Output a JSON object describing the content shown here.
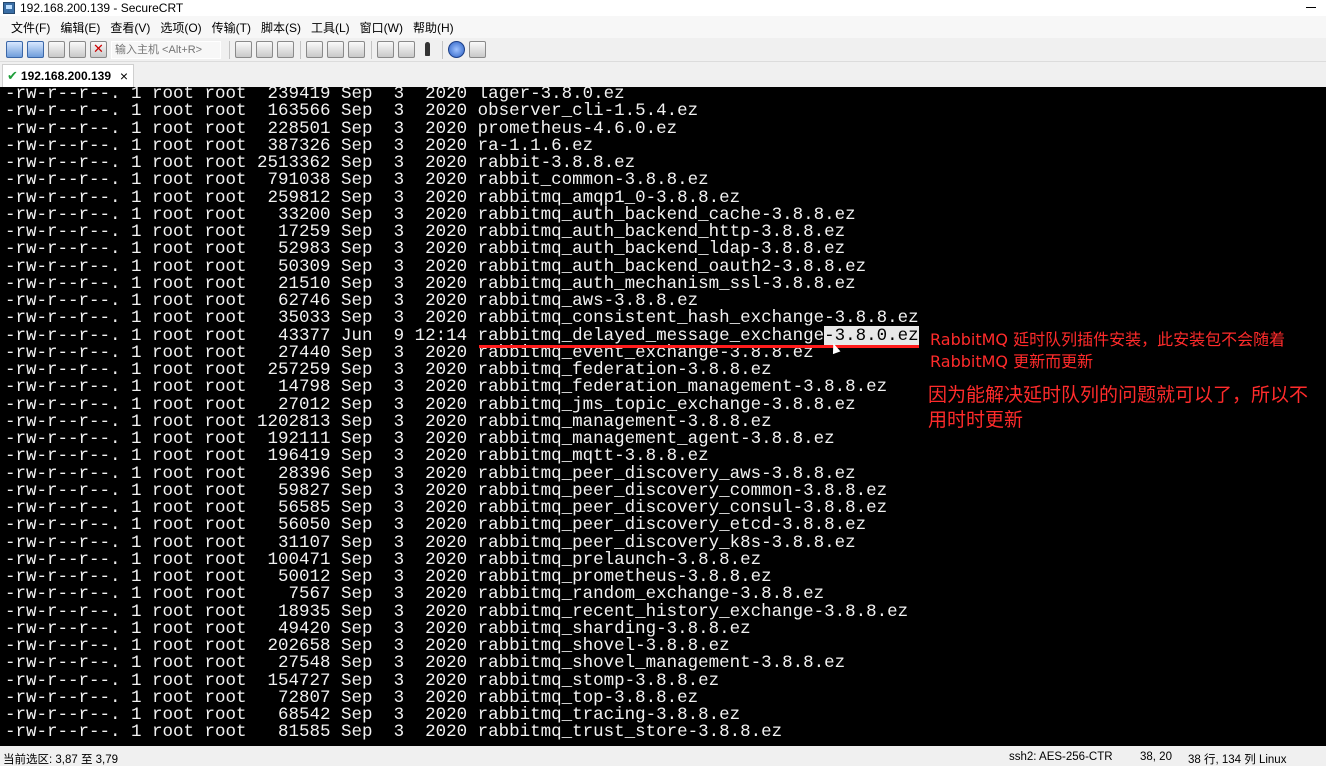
{
  "window": {
    "title": "192.168.200.139 - SecureCRT"
  },
  "menu": [
    "文件(F)",
    "编辑(E)",
    "查看(V)",
    "选项(O)",
    "传输(T)",
    "脚本(S)",
    "工具(L)",
    "窗口(W)",
    "帮助(H)"
  ],
  "toolbar": {
    "host_placeholder": "输入主机 <Alt+R>"
  },
  "tab": {
    "label": "192.168.200.139",
    "close": "×"
  },
  "terminal": {
    "lines": [
      "-rw-r--r--. 1 root root  239419 Sep  3  2020 lager-3.8.0.ez",
      "-rw-r--r--. 1 root root  163566 Sep  3  2020 observer_cli-1.5.4.ez",
      "-rw-r--r--. 1 root root  228501 Sep  3  2020 prometheus-4.6.0.ez",
      "-rw-r--r--. 1 root root  387326 Sep  3  2020 ra-1.1.6.ez",
      "-rw-r--r--. 1 root root 2513362 Sep  3  2020 rabbit-3.8.8.ez",
      "-rw-r--r--. 1 root root  791038 Sep  3  2020 rabbit_common-3.8.8.ez",
      "-rw-r--r--. 1 root root  259812 Sep  3  2020 rabbitmq_amqp1_0-3.8.8.ez",
      "-rw-r--r--. 1 root root   33200 Sep  3  2020 rabbitmq_auth_backend_cache-3.8.8.ez",
      "-rw-r--r--. 1 root root   17259 Sep  3  2020 rabbitmq_auth_backend_http-3.8.8.ez",
      "-rw-r--r--. 1 root root   52983 Sep  3  2020 rabbitmq_auth_backend_ldap-3.8.8.ez",
      "-rw-r--r--. 1 root root   50309 Sep  3  2020 rabbitmq_auth_backend_oauth2-3.8.8.ez",
      "-rw-r--r--. 1 root root   21510 Sep  3  2020 rabbitmq_auth_mechanism_ssl-3.8.8.ez",
      "-rw-r--r--. 1 root root   62746 Sep  3  2020 rabbitmq_aws-3.8.8.ez",
      "-rw-r--r--. 1 root root   35033 Sep  3  2020 rabbitmq_consistent_hash_exchange-3.8.8.ez",
      "-rw-r--r--. 1 root root   43377 Jun  9 12:14 rabbitmq_delayed_message_exchange-3.8.0.ez",
      "-rw-r--r--. 1 root root   27440 Sep  3  2020 rabbitmq_event_exchange-3.8.8.ez",
      "-rw-r--r--. 1 root root  257259 Sep  3  2020 rabbitmq_federation-3.8.8.ez",
      "-rw-r--r--. 1 root root   14798 Sep  3  2020 rabbitmq_federation_management-3.8.8.ez",
      "-rw-r--r--. 1 root root   27012 Sep  3  2020 rabbitmq_jms_topic_exchange-3.8.8.ez",
      "-rw-r--r--. 1 root root 1202813 Sep  3  2020 rabbitmq_management-3.8.8.ez",
      "-rw-r--r--. 1 root root  192111 Sep  3  2020 rabbitmq_management_agent-3.8.8.ez",
      "-rw-r--r--. 1 root root  196419 Sep  3  2020 rabbitmq_mqtt-3.8.8.ez",
      "-rw-r--r--. 1 root root   28396 Sep  3  2020 rabbitmq_peer_discovery_aws-3.8.8.ez",
      "-rw-r--r--. 1 root root   59827 Sep  3  2020 rabbitmq_peer_discovery_common-3.8.8.ez",
      "-rw-r--r--. 1 root root   56585 Sep  3  2020 rabbitmq_peer_discovery_consul-3.8.8.ez",
      "-rw-r--r--. 1 root root   56050 Sep  3  2020 rabbitmq_peer_discovery_etcd-3.8.8.ez",
      "-rw-r--r--. 1 root root   31107 Sep  3  2020 rabbitmq_peer_discovery_k8s-3.8.8.ez",
      "-rw-r--r--. 1 root root  100471 Sep  3  2020 rabbitmq_prelaunch-3.8.8.ez",
      "-rw-r--r--. 1 root root   50012 Sep  3  2020 rabbitmq_prometheus-3.8.8.ez",
      "-rw-r--r--. 1 root root    7567 Sep  3  2020 rabbitmq_random_exchange-3.8.8.ez",
      "-rw-r--r--. 1 root root   18935 Sep  3  2020 rabbitmq_recent_history_exchange-3.8.8.ez",
      "-rw-r--r--. 1 root root   49420 Sep  3  2020 rabbitmq_sharding-3.8.8.ez",
      "-rw-r--r--. 1 root root  202658 Sep  3  2020 rabbitmq_shovel-3.8.8.ez",
      "-rw-r--r--. 1 root root   27548 Sep  3  2020 rabbitmq_shovel_management-3.8.8.ez",
      "-rw-r--r--. 1 root root  154727 Sep  3  2020 rabbitmq_stomp-3.8.8.ez",
      "-rw-r--r--. 1 root root   72807 Sep  3  2020 rabbitmq_top-3.8.8.ez",
      "-rw-r--r--. 1 root root   68542 Sep  3  2020 rabbitmq_tracing-3.8.8.ez",
      "-rw-r--r--. 1 root root   81585 Sep  3  2020 rabbitmq_trust_store-3.8.8.ez"
    ],
    "selection": {
      "line_index": 14,
      "text": "-3.8.0.ez"
    }
  },
  "annotations": {
    "note1": "RabbitMQ 延时队列插件安装，此安装包不会随着 RabbitMQ 更新而更新",
    "note2": "因为能解决延时队列的问题就可以了，所以不用时时更新",
    "color": "#ff2b2b"
  },
  "status": {
    "selection": "当前选区: 3,87 至 3,79",
    "encryption": "ssh2: AES-256-CTR",
    "position": "38, 20",
    "size": "38 行, 134 列 Linux"
  }
}
